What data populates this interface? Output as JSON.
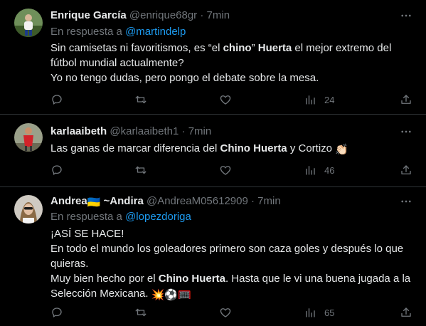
{
  "tweets": [
    {
      "name": "Enrique García",
      "handle": "@enrique68gr",
      "dot": "·",
      "time": "7min",
      "reply_prefix": "En respuesta a",
      "reply_to": "@martindelp",
      "lines": [
        [
          "Sin camisetas ni favoritismos, es “el ",
          "chino",
          "” ",
          "Huerta",
          " el mejor extremo del"
        ],
        "fútbol mundial actualmente?",
        "Yo no tengo dudas, pero pongo el debate sobre la mesa."
      ],
      "views": "24"
    },
    {
      "name": "karlaaibeth",
      "handle": "@karlaaibeth1",
      "dot": "·",
      "time": "7min",
      "text_before": "Las ganas de marcar diferencia del ",
      "text_bold": "Chino Huerta",
      "text_after": " y Cortizo ",
      "emoji": "👏🏻",
      "views": "46"
    },
    {
      "name_part1": "Andrea",
      "flag_emoji": "🇺🇦",
      "name_part2": " ~Andira",
      "handle": "@AndreaM05612909",
      "dot": "·",
      "time": "7min",
      "reply_prefix": "En respuesta a",
      "reply_to": "@lopezdoriga",
      "line1": "¡ASÍ SE HACE!",
      "line2": "En todo el mundo los goleadores primero son caza goles y después lo que",
      "line3": "quieras.",
      "line4_before": "Muy bien hecho por el ",
      "line4_bold": "Chino Huerta",
      "line4_after": ". Hasta que le vi una buena jugada a la",
      "line5": "Selección Mexicana. ",
      "line5_emoji": "💥⚽🥅",
      "views": "65"
    }
  ],
  "icons": {
    "reply": "speech-bubble-icon",
    "retweet": "retweet-arrows-icon",
    "like": "heart-icon",
    "views": "bar-chart-icon",
    "share": "share-arrow-icon",
    "more": "ellipsis-icon"
  },
  "colors": {
    "background": "#000000",
    "text": "#e7e9ea",
    "muted": "#71767b",
    "link": "#1d9bf0",
    "divider": "#2f3336"
  }
}
